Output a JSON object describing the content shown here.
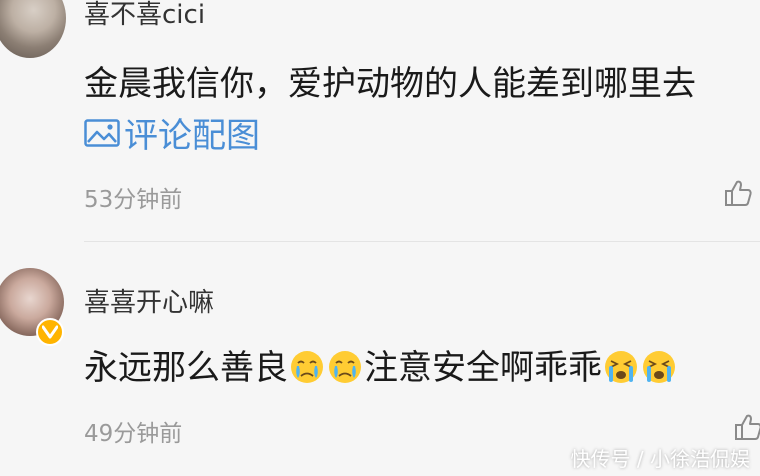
{
  "comments": [
    {
      "username": "喜不喜cici",
      "content": "金晨我信你，爱护动物的人能差到哪里去",
      "image_link_label": "评论配图",
      "time": "53分钟前"
    },
    {
      "username": "喜喜开心嘛",
      "content_part1": "永远那么善良",
      "content_part2": "注意安全啊乖乖",
      "time": "49分钟前",
      "verified": true
    }
  ],
  "watermark": "快传号 / 小徐浩侃娱",
  "colors": {
    "background": "#f6f6f6",
    "link": "#4a8ed6",
    "timestamp": "#9a9a9a",
    "badge": "#ffb400"
  }
}
